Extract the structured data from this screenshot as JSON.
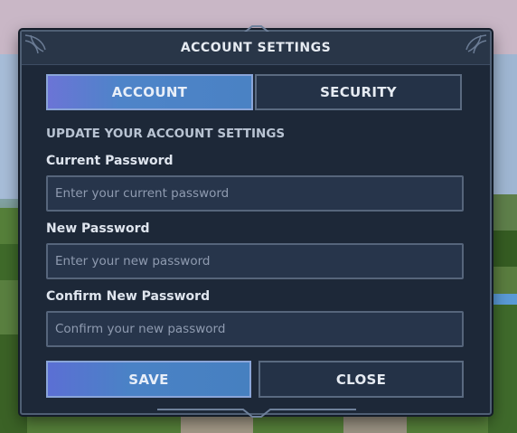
{
  "dialog": {
    "title": "ACCOUNT SETTINGS",
    "tabs": [
      {
        "label": "ACCOUNT",
        "active": true
      },
      {
        "label": "SECURITY",
        "active": false
      }
    ],
    "section_heading": "UPDATE YOUR ACCOUNT SETTINGS",
    "fields": [
      {
        "label": "Current Password",
        "value": "",
        "placeholder": "Enter your current password"
      },
      {
        "label": "New Password",
        "value": "",
        "placeholder": "Enter your new password"
      },
      {
        "label": "Confirm New Password",
        "value": "",
        "placeholder": "Confirm your new password"
      }
    ],
    "buttons": {
      "save_label": "SAVE",
      "close_label": "CLOSE"
    }
  },
  "colors": {
    "panel_bg": "#1d2838",
    "accent_gradient_start": "#6b74d6",
    "accent_gradient_end": "#4a82c4",
    "inactive_bg": "#243247"
  }
}
